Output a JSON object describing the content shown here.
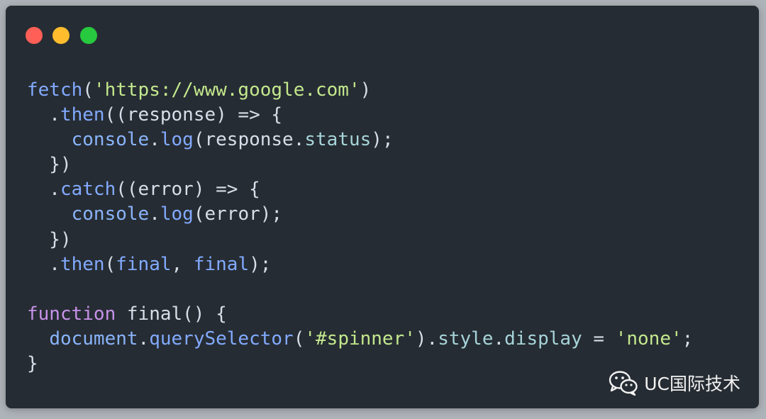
{
  "window": {
    "traffic_lights": [
      {
        "name": "close",
        "color": "#ff5f56"
      },
      {
        "name": "minimize",
        "color": "#ffbd2e"
      },
      {
        "name": "maximize",
        "color": "#27c93f"
      }
    ]
  },
  "colors": {
    "background": "#262c33",
    "default": "#d8dee9",
    "function": "#82aaff",
    "string": "#c3e88d",
    "keyword": "#c792ea",
    "object": "#89b4fa",
    "property": "#a6d4d9"
  },
  "code": {
    "lines": [
      [
        {
          "t": "fetch",
          "c": "function"
        },
        {
          "t": "(",
          "c": "default"
        },
        {
          "t": "'https://www.google.com'",
          "c": "string"
        },
        {
          "t": ")",
          "c": "default"
        }
      ],
      [
        {
          "t": "  .",
          "c": "default"
        },
        {
          "t": "then",
          "c": "function"
        },
        {
          "t": "((response) => {",
          "c": "default"
        }
      ],
      [
        {
          "t": "    ",
          "c": "default"
        },
        {
          "t": "console",
          "c": "object"
        },
        {
          "t": ".",
          "c": "default"
        },
        {
          "t": "log",
          "c": "function"
        },
        {
          "t": "(response.",
          "c": "default"
        },
        {
          "t": "status",
          "c": "property"
        },
        {
          "t": ");",
          "c": "default"
        }
      ],
      [
        {
          "t": "  })",
          "c": "default"
        }
      ],
      [
        {
          "t": "  .",
          "c": "default"
        },
        {
          "t": "catch",
          "c": "function"
        },
        {
          "t": "((error) => {",
          "c": "default"
        }
      ],
      [
        {
          "t": "    ",
          "c": "default"
        },
        {
          "t": "console",
          "c": "object"
        },
        {
          "t": ".",
          "c": "default"
        },
        {
          "t": "log",
          "c": "function"
        },
        {
          "t": "(error);",
          "c": "default"
        }
      ],
      [
        {
          "t": "  })",
          "c": "default"
        }
      ],
      [
        {
          "t": "  .",
          "c": "default"
        },
        {
          "t": "then",
          "c": "function"
        },
        {
          "t": "(",
          "c": "default"
        },
        {
          "t": "final",
          "c": "function"
        },
        {
          "t": ", ",
          "c": "default"
        },
        {
          "t": "final",
          "c": "function"
        },
        {
          "t": ");",
          "c": "default"
        }
      ],
      [
        {
          "t": "",
          "c": "default"
        }
      ],
      [
        {
          "t": "function",
          "c": "keyword"
        },
        {
          "t": " final() {",
          "c": "default"
        }
      ],
      [
        {
          "t": "  ",
          "c": "default"
        },
        {
          "t": "document",
          "c": "object"
        },
        {
          "t": ".",
          "c": "default"
        },
        {
          "t": "querySelector",
          "c": "function"
        },
        {
          "t": "(",
          "c": "default"
        },
        {
          "t": "'#spinner'",
          "c": "string"
        },
        {
          "t": ").",
          "c": "default"
        },
        {
          "t": "style",
          "c": "property"
        },
        {
          "t": ".",
          "c": "default"
        },
        {
          "t": "display",
          "c": "property"
        },
        {
          "t": " = ",
          "c": "default"
        },
        {
          "t": "'none'",
          "c": "string"
        },
        {
          "t": ";",
          "c": "default"
        }
      ],
      [
        {
          "t": "}",
          "c": "default"
        }
      ]
    ]
  },
  "watermark": {
    "text": "UC国际技术",
    "icon": "wechat-icon"
  }
}
